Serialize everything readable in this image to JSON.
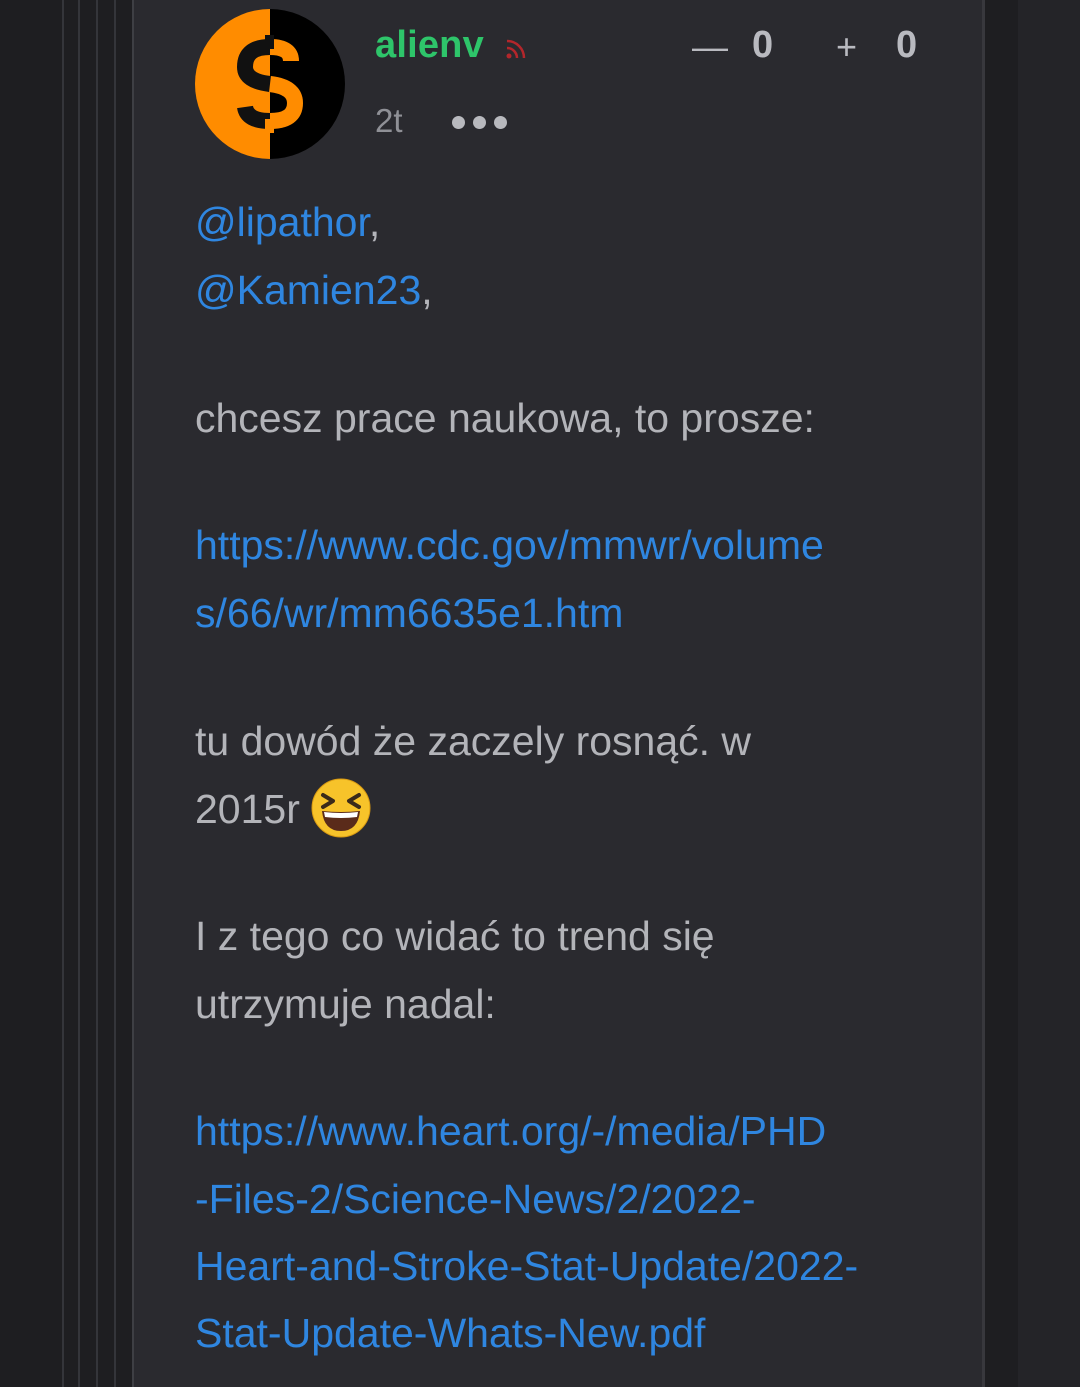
{
  "comment": {
    "author": "alienv",
    "time": "2t",
    "votes": {
      "minus_symbol": "—",
      "minus_count": "0",
      "plus_symbol": "+",
      "plus_count": "0"
    },
    "mentions": [
      "@lipathor",
      "@Kamien23"
    ],
    "mention_separator": ",",
    "paragraph1": "chcesz prace naukowa, to prosze:",
    "link1_line1": "https://www.cdc.gov/mmwr/volume",
    "link1_line2": "s/66/wr/mm6635e1.htm",
    "paragraph2_line1": "tu dowód że zaczely rosnąć. w",
    "paragraph2_line2": "2015r",
    "paragraph3_line1": "I z tego co widać to trend się",
    "paragraph3_line2": "utrzymuje nadal:",
    "link2_line1": "https://www.heart.org/-/media/PHD",
    "link2_line2": "-Files-2/Science-News/2/2022-",
    "link2_line3": "Heart-and-Stroke-Stat-Update/2022-",
    "link2_line4": "Stat-Update-Whats-New.pdf"
  },
  "icons": {
    "avatar": "dollar-avatar-icon",
    "rss": "rss-icon",
    "more": "more-options-icon",
    "emoji": "laughing-emoji-icon"
  },
  "colors": {
    "background": "#1e1e21",
    "panel": "#2a2a2f",
    "author": "#2ec56a",
    "link": "#2f86e0",
    "text": "#b3b4b9",
    "avatar_orange": "#ff8c00",
    "avatar_black": "#000000"
  }
}
